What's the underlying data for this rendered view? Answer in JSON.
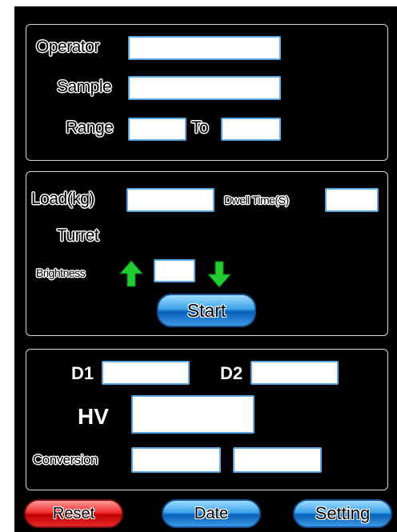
{
  "colors": {
    "background": "#000000",
    "field_border": "#5ba8e0",
    "arrow_green": "#22cc33",
    "button_blue": "#2f8fe0",
    "button_red": "#e02020"
  },
  "operator_panel": {
    "operator_label": "Operator",
    "sample_label": "Sample",
    "range_label": "Range",
    "to_label": "To",
    "operator_value": "",
    "sample_value": "",
    "range_from_value": "",
    "range_to_value": ""
  },
  "test_panel": {
    "load_label": "Load(kg)",
    "dwell_label": "Dwell Time(S)",
    "turret_label": "Turret",
    "brightness_label": "Brightness",
    "start_label": "Start",
    "load_value": "",
    "dwell_value": "",
    "brightness_value": "",
    "up_icon": "arrow-up-icon",
    "down_icon": "arrow-down-icon"
  },
  "result_panel": {
    "d1_label": "D1",
    "d2_label": "D2",
    "hv_label": "HV",
    "conversion_label": "Conversion",
    "d1_value": "",
    "d2_value": "",
    "hv_value": "",
    "conversion_value_1": "",
    "conversion_value_2": ""
  },
  "bottom_bar": {
    "reset_label": "Reset",
    "date_label": "Date",
    "setting_label": "Setting"
  }
}
